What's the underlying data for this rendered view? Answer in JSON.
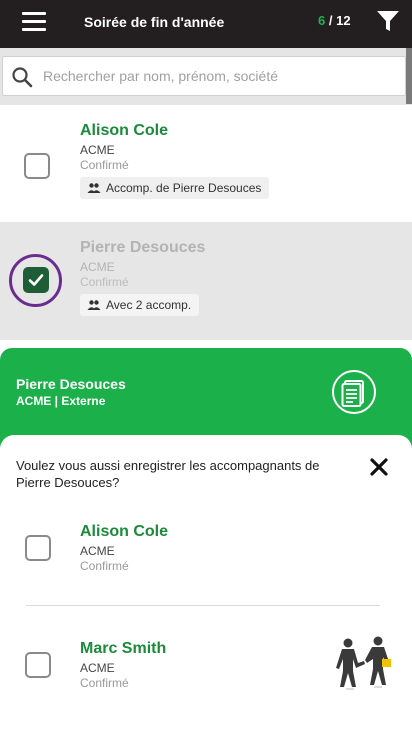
{
  "header": {
    "title": "Soirée de fin d'année",
    "checked_count": "6",
    "total_count": "/ 12"
  },
  "search": {
    "placeholder": "Rechercher par nom, prénom, société"
  },
  "guests": [
    {
      "name": "Alison Cole",
      "company": "ACME",
      "status": "Confirmé",
      "badge": "Accomp. de Pierre Desouces",
      "checked": false
    },
    {
      "name": "Pierre Desouces",
      "company": "ACME",
      "status": "Confirmé",
      "badge": "Avec 2 accomp.",
      "checked": true
    }
  ],
  "selected_guest": {
    "name": "Pierre Desouces",
    "subtitle": "ACME | Externe"
  },
  "dialog": {
    "question": "Voulez vous aussi enregistrer les accompagnants de Pierre Desouces?",
    "companions": [
      {
        "name": "Alison Cole",
        "company": "ACME",
        "status": "Confirmé"
      },
      {
        "name": "Marc Smith",
        "company": "ACME",
        "status": "Confirmé"
      }
    ]
  },
  "colors": {
    "topbar": "#231f20",
    "accent_green": "#1cb04b",
    "name_green": "#1b8a3a",
    "checkbox_checked": "#1e5e37",
    "focus_ring": "#6a2d8f"
  },
  "icons": [
    "menu-icon",
    "filter-icon",
    "search-icon",
    "people-icon",
    "check-icon",
    "document-icon",
    "close-icon",
    "handshake-icon"
  ]
}
